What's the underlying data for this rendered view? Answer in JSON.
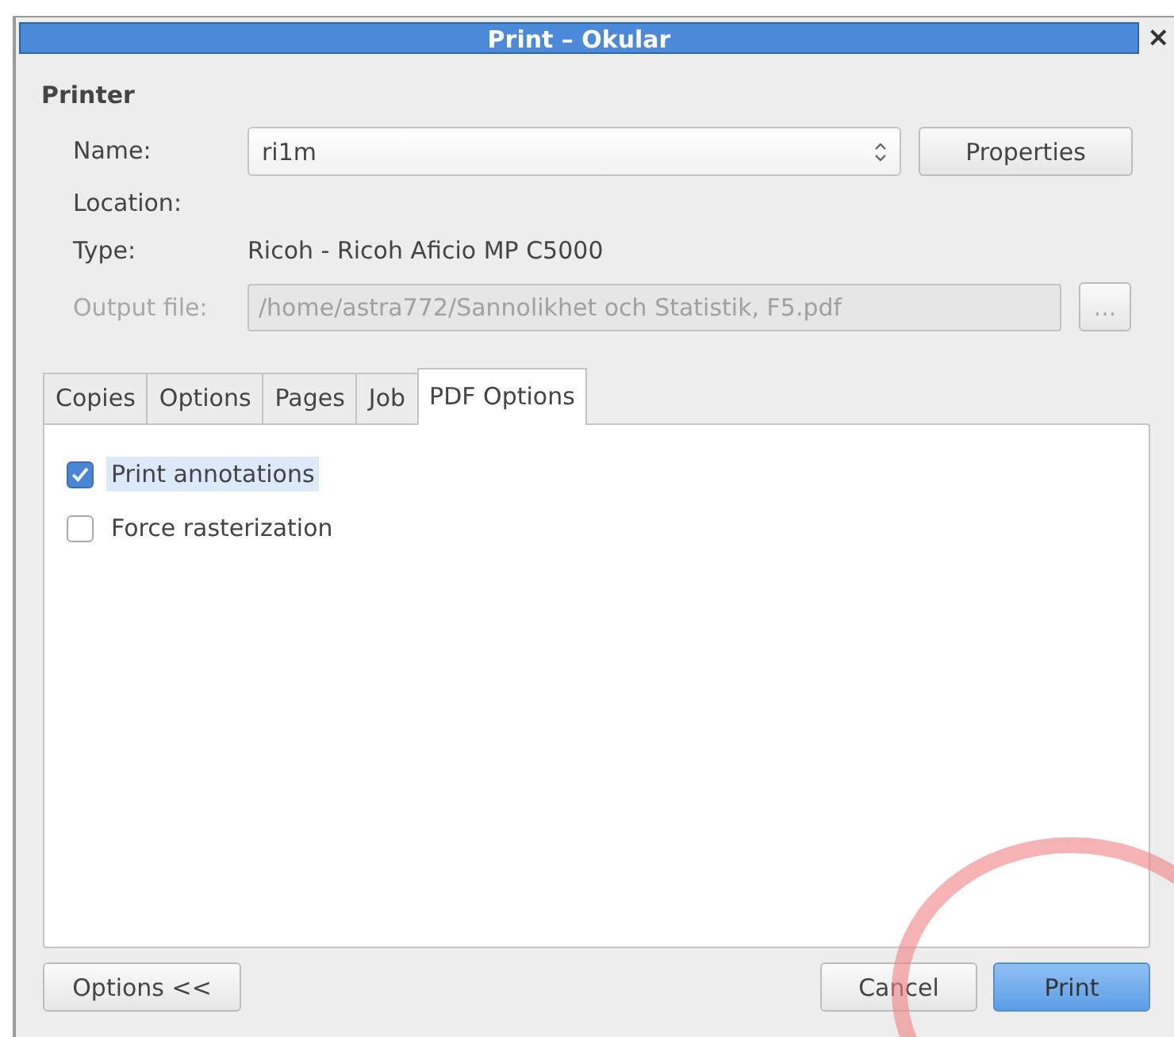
{
  "window": {
    "title": "Print – Okular",
    "close": "×"
  },
  "printer": {
    "heading": "Printer",
    "name_label": "Name:",
    "name_value": "ri1m",
    "properties_button": "Properties",
    "location_label": "Location:",
    "type_label": "Type:",
    "type_value": "Ricoh - Ricoh Aficio MP C5000",
    "output_label": "Output file:",
    "output_value": "/home/astra772/Sannolikhet och Statistik, F5.pdf",
    "output_disabled": true,
    "browse_button": "..."
  },
  "tabs": [
    {
      "label": "Copies",
      "selected": false
    },
    {
      "label": "Options",
      "selected": false
    },
    {
      "label": "Pages",
      "selected": false
    },
    {
      "label": "Job",
      "selected": false
    },
    {
      "label": "PDF Options",
      "selected": true
    }
  ],
  "options": [
    {
      "label": "Print annotations",
      "checked": true,
      "selected": true
    },
    {
      "label": "Force rasterization",
      "checked": false,
      "selected": false
    }
  ],
  "buttons": [
    {
      "label": "Options <<",
      "kind": "normal"
    },
    {
      "label": "Cancel",
      "kind": "normal"
    },
    {
      "label": "Print",
      "kind": "default"
    }
  ]
}
